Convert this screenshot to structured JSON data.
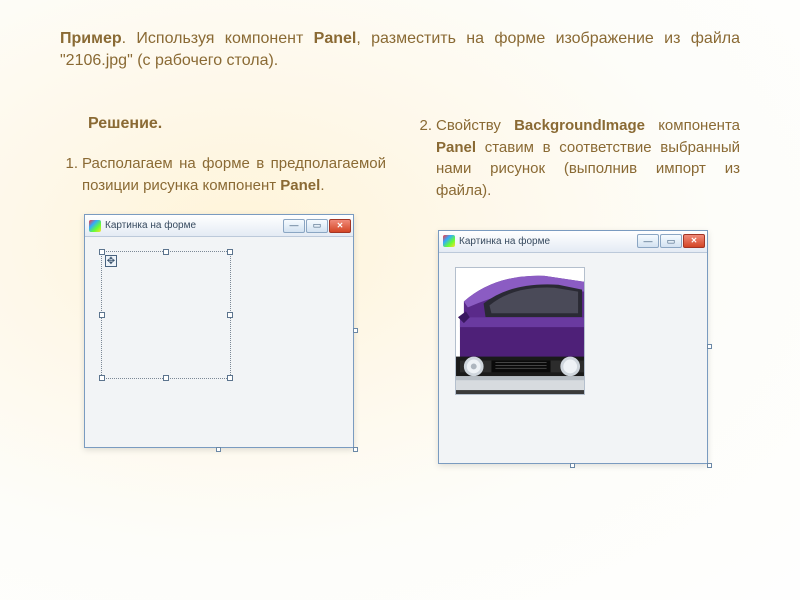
{
  "intro": {
    "lead": "Пример",
    "text_before": ". Используя компонент ",
    "panel": "Panel",
    "text_after": ", разместить на форме изображение из файла \"2106.jpg\" (с рабочего стола)."
  },
  "left": {
    "heading": "Решение.",
    "step_num": "1.",
    "step_pre": "Располагаем на форме в предполагаемой позиции рисунка компонент ",
    "step_bold": "Panel",
    "step_post": "."
  },
  "right": {
    "step_num": "2.",
    "t1": "Свойству ",
    "b1": "BackgroundImage",
    "t2": " компонента ",
    "b2": "Panel",
    "t3": " ставим в соответствие выбранный нами рисунок (выполнив импорт из файла)."
  },
  "window": {
    "title": "Картинка на форме",
    "minimize_glyph": "—",
    "maximize_glyph": "▭"
  }
}
